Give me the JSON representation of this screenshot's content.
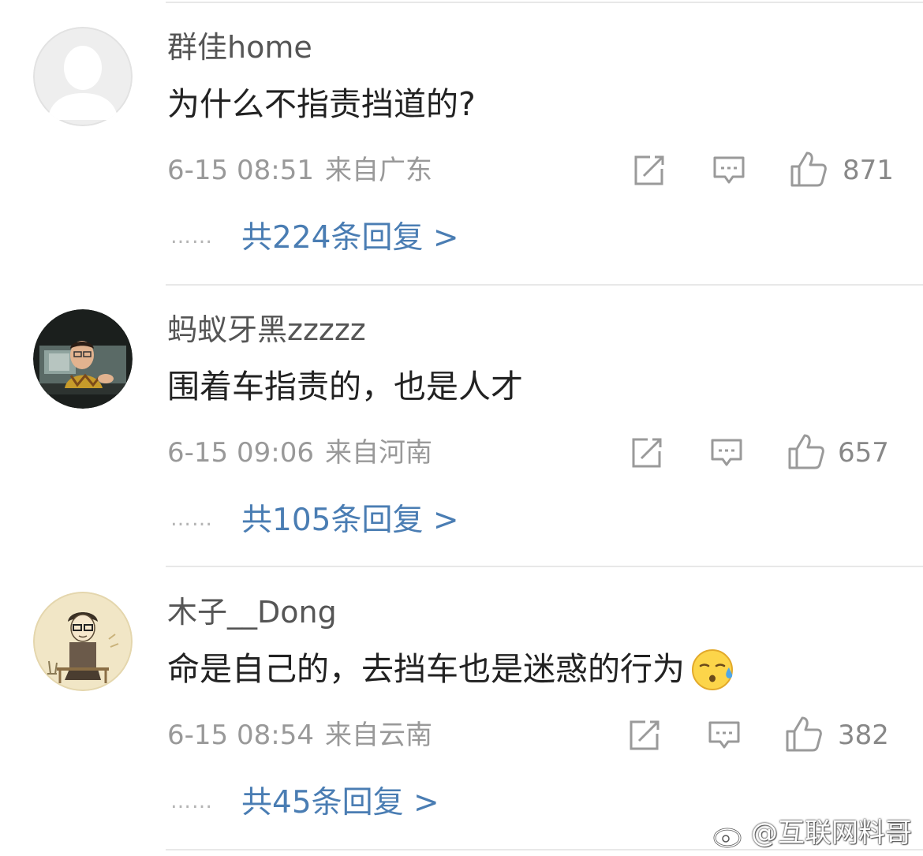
{
  "comments": [
    {
      "username": "群佳home",
      "content": "为什么不指责挡道的?",
      "date": "6-15 08:51",
      "location": "来自广东",
      "likes": "871",
      "replies": "共224条回复 >",
      "dots": "……"
    },
    {
      "username": "蚂蚁牙黑zzzzz",
      "content": "围着车指责的，也是人才",
      "date": "6-15 09:06",
      "location": "来自河南",
      "likes": "657",
      "replies": "共105条回复 >",
      "dots": "……"
    },
    {
      "username": "木子__Dong",
      "content": "命是自己的，去挡车也是迷惑的行为",
      "date": "6-15 08:54",
      "location": "来自云南",
      "likes": "382",
      "replies": "共45条回复 >",
      "dots": "……"
    }
  ],
  "watermark": "@互联网料哥",
  "icons": {
    "share": "share-icon",
    "comment": "comment-icon",
    "like": "thumbs-up-icon",
    "emoji": "sweat-emoji-icon",
    "watermark_logo": "weibo-logo-icon"
  },
  "colors": {
    "link": "#4a7db3",
    "meta": "#999999",
    "text": "#222222",
    "divider": "#e8e8e8"
  }
}
